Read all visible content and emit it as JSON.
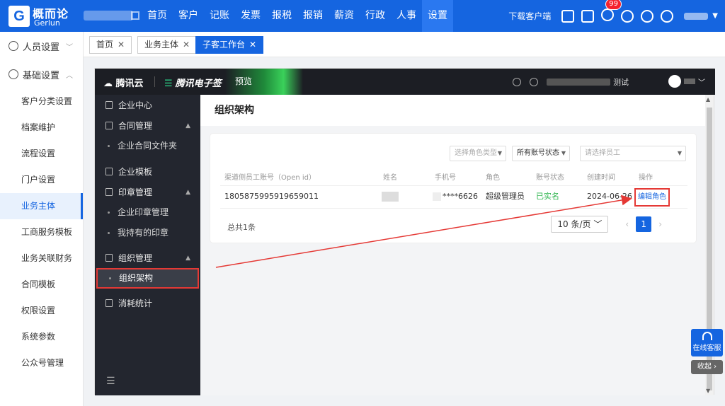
{
  "header": {
    "logo_cn": "概而论",
    "logo_en": "Gerlun",
    "logo_mark": "G",
    "nav": [
      "首页",
      "客户",
      "记账",
      "发票",
      "报税",
      "报销",
      "薪资",
      "行政",
      "人事",
      "设置"
    ],
    "nav_active_index": 9,
    "download_label": "下载客户端",
    "notification_count": "99"
  },
  "sidebar": {
    "groups": [
      {
        "label": "人员设置",
        "expanded": false
      },
      {
        "label": "基础设置",
        "expanded": true
      }
    ],
    "items": [
      "客户分类设置",
      "档案维护",
      "流程设置",
      "门户设置",
      "业务主体",
      "工商服务模板",
      "业务关联财务",
      "合同模板",
      "权限设置",
      "系统参数",
      "公众号管理"
    ],
    "active_item": "业务主体"
  },
  "tabs": [
    {
      "label": "首页",
      "active": false
    },
    {
      "label": "业务主体",
      "active": false
    },
    {
      "label": "子客工作台",
      "active": true
    }
  ],
  "esign": {
    "brand_tc": "腾讯云",
    "brand_es": "腾讯电子签",
    "preview_label": "预览",
    "account_suffix": "测试",
    "menu": [
      {
        "type": "head",
        "label": "企业中心"
      },
      {
        "type": "head",
        "label": "合同管理",
        "expanded": true
      },
      {
        "type": "sub",
        "label": "企业合同文件夹"
      },
      {
        "type": "head",
        "label": "企业模板"
      },
      {
        "type": "head",
        "label": "印章管理",
        "expanded": true
      },
      {
        "type": "sub",
        "label": "企业印章管理"
      },
      {
        "type": "sub",
        "label": "我持有的印章"
      },
      {
        "type": "head",
        "label": "组织管理",
        "expanded": true
      },
      {
        "type": "sub",
        "label": "组织架构",
        "active": true
      },
      {
        "type": "head",
        "label": "消耗统计"
      }
    ],
    "page_title": "组织架构",
    "filters": {
      "role_type_placeholder": "选择角色类型",
      "account_status": "所有账号状态",
      "employee_placeholder": "请选择员工"
    },
    "table": {
      "columns": [
        "渠道侧员工账号（Open id）",
        "姓名",
        "手机号",
        "角色",
        "账号状态",
        "创建时间",
        "操作"
      ],
      "rows": [
        {
          "open_id": "1805875995919659011",
          "phone": "****6626",
          "role": "超级管理员",
          "status": "已实名",
          "created": "2024-06-26",
          "action": "编辑角色"
        }
      ]
    },
    "total_label": "总共1条",
    "page_size": "10 条/页",
    "current_page": "1"
  },
  "float": {
    "support_label": "在线客服",
    "collapse_label": "收起"
  },
  "colors": {
    "primary": "#1565e0",
    "highlight": "#e53935",
    "success": "#29b34a"
  }
}
